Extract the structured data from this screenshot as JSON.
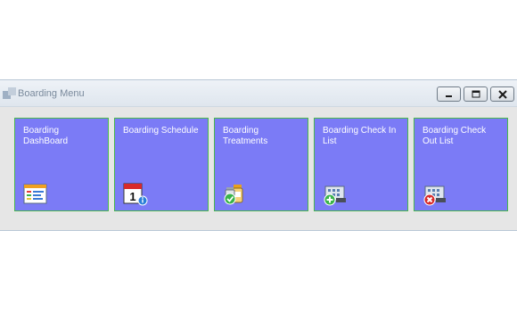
{
  "window": {
    "title": "Boarding Menu",
    "app_icon": "app-window-icon",
    "controls": [
      "minimize-icon",
      "restore-icon",
      "close-icon"
    ]
  },
  "tiles": [
    {
      "label": "Boarding DashBoard",
      "icon": "dashboard-report-icon"
    },
    {
      "label": "Boarding Schedule",
      "icon": "calendar-info-icon"
    },
    {
      "label": "Boarding Treatments",
      "icon": "medication-check-icon"
    },
    {
      "label": "Boarding Check In List",
      "icon": "building-add-icon"
    },
    {
      "label": "Boarding Check Out List",
      "icon": "building-remove-icon"
    }
  ],
  "colors": {
    "tile_background": "#7b7bf6",
    "tile_border": "#48b84c",
    "window_background": "#e6e6e6"
  }
}
